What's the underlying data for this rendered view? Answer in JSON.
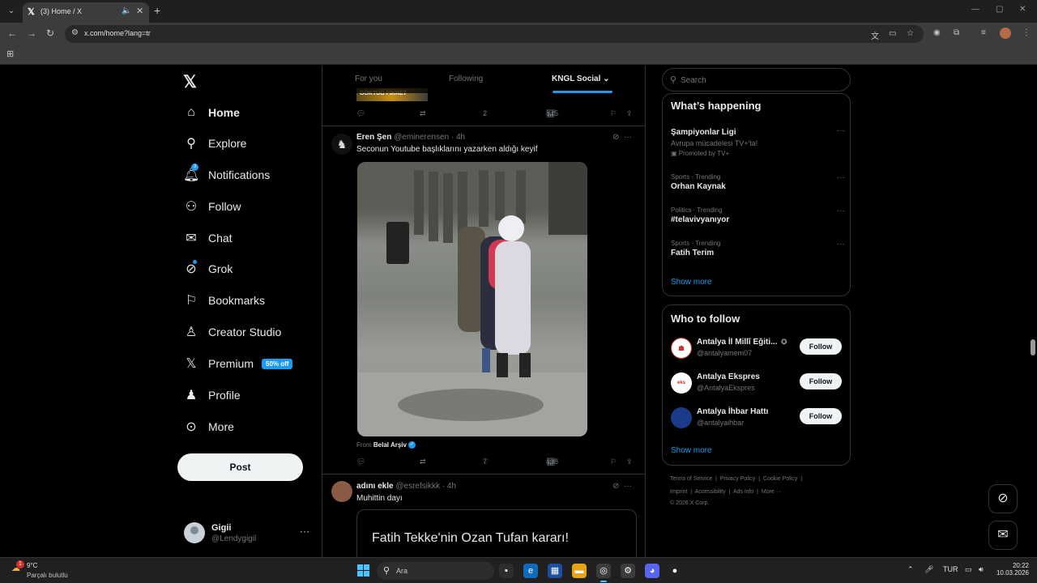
{
  "browser": {
    "tab_title": "(3) Home / X",
    "url": "x.com/home?lang=tr"
  },
  "nav": {
    "items": [
      {
        "label": "Home",
        "icon": "home-icon"
      },
      {
        "label": "Explore",
        "icon": "search-icon"
      },
      {
        "label": "Notifications",
        "icon": "bell-icon",
        "badge": "3"
      },
      {
        "label": "Follow",
        "icon": "person-plus-icon"
      },
      {
        "label": "Chat",
        "icon": "mail-icon"
      },
      {
        "label": "Grok",
        "icon": "grok-icon"
      },
      {
        "label": "Bookmarks",
        "icon": "bookmark-icon"
      },
      {
        "label": "Creator Studio",
        "icon": "creator-studio-icon"
      },
      {
        "label": "Premium",
        "icon": "x-icon",
        "promo": "50% off"
      },
      {
        "label": "Profile",
        "icon": "person-icon"
      },
      {
        "label": "More",
        "icon": "more-circle-icon"
      }
    ],
    "post_label": "Post",
    "account": {
      "name": "Gigii",
      "handle": "@Lendygigil"
    }
  },
  "feed": {
    "tabs": [
      {
        "label": "For you"
      },
      {
        "label": "Following"
      },
      {
        "label": "KNGL Social",
        "active": true
      }
    ],
    "prev_tweet": {
      "strip_text": "GÖKTUĞ FİKRET",
      "likes": "2",
      "views": "875"
    },
    "tweets": [
      {
        "name": "Eren Şen",
        "handle": "@eminerensen",
        "time": "· 4h",
        "text": "Seconun Youtube başlıklarını yazarken aldığı keyif",
        "from_prefix": "From",
        "from_name": "Belal Arşiv",
        "likes": "7",
        "views": "498"
      },
      {
        "name": "adını ekle",
        "handle": "@esrefsikkk",
        "time": "· 4h",
        "text": "Muhittin dayı",
        "card_title": "Fatih Tekke'nin Ozan Tufan kararı!"
      }
    ]
  },
  "sidebar": {
    "search_placeholder": "Search",
    "trends_title": "What’s happening",
    "trends": [
      {
        "context": "",
        "title": "Şampiyonlar Ligi",
        "subtitle": "Avrupa mücadelesi TV+'ta!",
        "promoted": "Promoted by TV+"
      },
      {
        "context": "Sports · Trending",
        "title": "Orhan Kaynak"
      },
      {
        "context": "Politics · Trending",
        "title": "#telavivyanıyor"
      },
      {
        "context": "Sports · Trending",
        "title": "Fatih Terim"
      }
    ],
    "show_more": "Show more",
    "wtf_title": "Who to follow",
    "who_to_follow": [
      {
        "name": "Antalya İl Millî Eğiti...",
        "handle": "@antalyamem07",
        "button": "Follow"
      },
      {
        "name": "Antalya Ekspres",
        "handle": "@AntalyaEkspres",
        "button": "Follow"
      },
      {
        "name": "Antalya İhbar Hattı",
        "handle": "@antalyaihbar",
        "button": "Follow"
      }
    ],
    "footer_line1": [
      "Terms of Service",
      "Privacy Policy",
      "Cookie Policy"
    ],
    "footer_line2": [
      "Imprint",
      "Accessibility",
      "Ads info",
      "More ···"
    ],
    "copyright": "© 2026 X Corp."
  },
  "taskbar": {
    "weather_temp": "9°C",
    "weather_cond": "Parçalı bulutlu",
    "weather_badge": "1",
    "search_placeholder": "Ara",
    "lang": "TUR",
    "time": "20:22",
    "date": "10.03.2026"
  },
  "colors": {
    "accent": "#1d9bf0",
    "background": "#000000",
    "border": "#2f3336"
  }
}
